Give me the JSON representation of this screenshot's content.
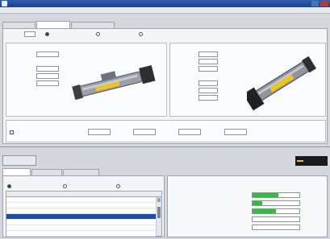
{
  "window": {
    "title": "",
    "minimize_label": "",
    "close_label": ""
  },
  "menu": [
    {
      "label": ""
    },
    {
      "label": ""
    },
    {
      "label": ""
    }
  ],
  "section_top": {
    "label": ""
  },
  "tabs_top": [
    {
      "label": ""
    },
    {
      "label": ""
    },
    {
      "label": ""
    }
  ],
  "selector": {
    "label": "",
    "value": "",
    "options": [
      {
        "label": "",
        "selected": true
      },
      {
        "label": "",
        "selected": false
      },
      {
        "label": "",
        "selected": false
      }
    ]
  },
  "left_group": {
    "title": "",
    "fields": [
      {
        "label": "",
        "value": ""
      },
      {
        "label": "",
        "value": ""
      },
      {
        "label": "",
        "value": ""
      },
      {
        "label": "",
        "value": ""
      }
    ]
  },
  "right_group": {
    "title": "",
    "fields": [
      {
        "label": "",
        "value": ""
      },
      {
        "label": "",
        "value": ""
      },
      {
        "label": "",
        "value": ""
      },
      {
        "label": "",
        "value": ""
      },
      {
        "label": "",
        "value": ""
      },
      {
        "label": "",
        "value": ""
      },
      {
        "label": "",
        "value": ""
      }
    ]
  },
  "bottom_group": {
    "title": "",
    "checkbox_label": "",
    "fields": [
      {
        "label": "",
        "value": "",
        "sub": ""
      },
      {
        "label": "",
        "value": "",
        "sub": ""
      },
      {
        "label": "",
        "value": "",
        "sub": ""
      },
      {
        "label": "",
        "value": "",
        "sub": ""
      }
    ]
  },
  "section_bottom": {
    "label": "",
    "action_button": "",
    "brand": ""
  },
  "tabs_bottom": [
    {
      "label": ""
    },
    {
      "label": ""
    },
    {
      "label": ""
    }
  ],
  "list_panel": {
    "title": "",
    "radios": [
      {
        "label": "",
        "selected": true
      },
      {
        "label": "",
        "selected": false
      },
      {
        "label": "",
        "selected": false
      }
    ],
    "columns": [
      "",
      "",
      ""
    ],
    "rows": [
      {
        "no": "",
        "name": "",
        "detail": ""
      },
      {
        "no": "",
        "name": "",
        "detail": ""
      },
      {
        "no": "",
        "name": "",
        "detail": ""
      },
      {
        "no": "",
        "name": "",
        "detail": ""
      },
      {
        "no": "",
        "name": "",
        "detail": ""
      },
      {
        "no": "",
        "name": "",
        "detail": ""
      },
      {
        "no": "",
        "name": "",
        "detail": ""
      }
    ]
  },
  "result_panel": {
    "heading": "",
    "bars": [
      {
        "label": "",
        "value": "",
        "unit": "",
        "fraction": 0.55
      },
      {
        "label": "",
        "value": "",
        "unit": "",
        "fraction": 0.2
      },
      {
        "label": "",
        "value": "",
        "unit": "",
        "fraction": 0.5
      },
      {
        "label": "",
        "value": "",
        "unit": "",
        "fraction": 0.0
      },
      {
        "label": "",
        "value": "",
        "unit": "",
        "fraction": 0.0
      }
    ]
  }
}
